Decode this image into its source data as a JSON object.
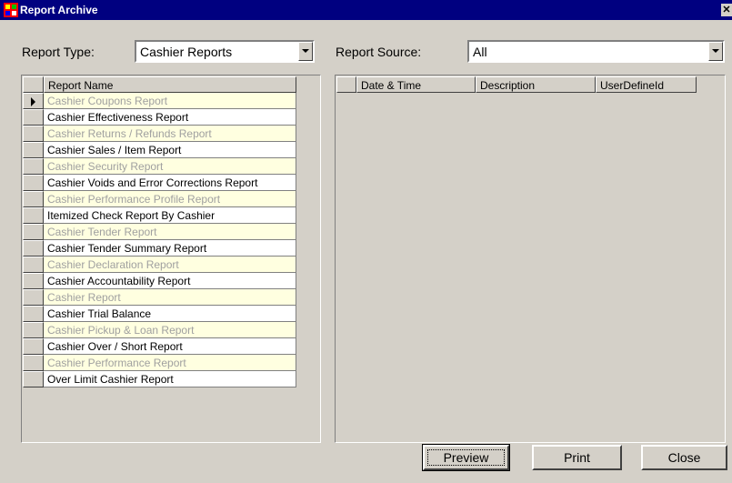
{
  "window": {
    "title": "Report Archive",
    "close_glyph": "✕"
  },
  "report_type": {
    "label": "Report Type:",
    "value": "Cashier Reports"
  },
  "report_source": {
    "label": "Report Source:",
    "value": "All"
  },
  "left_grid": {
    "header": "Report Name",
    "rows": [
      "Cashier Coupons Report",
      "Cashier Effectiveness Report",
      "Cashier Returns / Refunds Report",
      "Cashier Sales / Item Report",
      "Cashier Security Report",
      "Cashier Voids and Error Corrections Report",
      "Cashier Performance Profile Report",
      "Itemized Check Report By Cashier",
      "Cashier Tender Report",
      "Cashier Tender Summary Report",
      "Cashier Declaration Report",
      "Cashier Accountability Report",
      "Cashier Report",
      "Cashier Trial Balance",
      "Cashier Pickup & Loan Report",
      "Cashier Over / Short Report",
      "Cashier Performance Report",
      "Over Limit Cashier Report"
    ]
  },
  "right_grid": {
    "headers": [
      "Date & Time",
      "Description",
      "UserDefineId"
    ]
  },
  "buttons": {
    "preview": "Preview",
    "print": "Print",
    "close": "Close"
  },
  "colors": {
    "title_bar": "#000080",
    "alt_row_bg": "#ffffe0",
    "alt_row_text": "#a0a0a0"
  }
}
